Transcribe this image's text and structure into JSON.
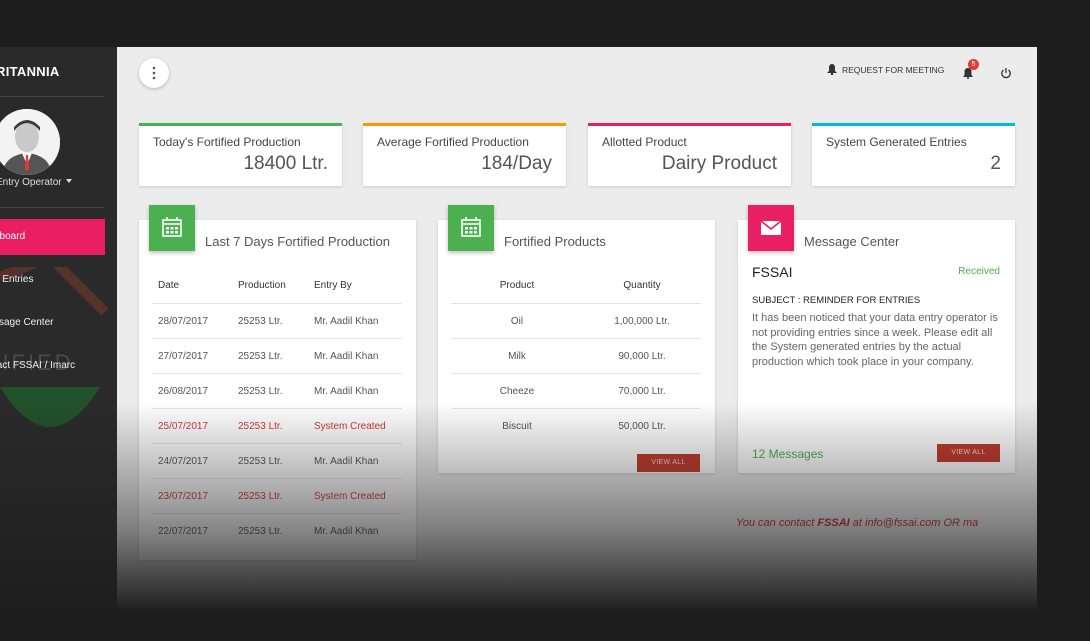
{
  "sidebar": {
    "brand": "RITANNIA",
    "user": "Entry Operator",
    "items": [
      {
        "label": "hboard",
        "active": true
      },
      {
        "label": "a Entries"
      },
      {
        "label": "ssage Center"
      },
      {
        "label": "tact FSSAI / Imarc"
      }
    ],
    "watermark_text": "TIFIED"
  },
  "topbar": {
    "request_label": "REQUEST FOR MEETING",
    "notification_count": "5"
  },
  "stats": [
    {
      "label": "Today's Fortified Production",
      "value": "18400 Ltr.",
      "color": "#4caf50"
    },
    {
      "label": "Average Fortified Production",
      "value": "184/Day",
      "color": "#ff9800"
    },
    {
      "label": "Allotted Product",
      "value": "Dairy Product",
      "color": "#e91e63"
    },
    {
      "label": "System Generated Entries",
      "value": "2",
      "color": "#00bcd4"
    }
  ],
  "production": {
    "title": "Last 7 Days Fortified Production",
    "headers": [
      "Date",
      "Production",
      "Entry By"
    ],
    "rows": [
      [
        "28/07/2017",
        "25253 Ltr.",
        "Mr. Aadil Khan"
      ],
      [
        "27/07/2017",
        "25253 Ltr.",
        "Mr. Aadil Khan"
      ],
      [
        "26/08/2017",
        "25253 Ltr.",
        "Mr. Aadil Khan"
      ],
      [
        "25/07/2017",
        "25253 Ltr.",
        "System Created"
      ],
      [
        "24/07/2017",
        "25253 Ltr.",
        "Mr. Aadil Khan"
      ],
      [
        "23/07/2017",
        "25253 Ltr.",
        "System Created"
      ],
      [
        "22/07/2017",
        "25253 Ltr.",
        "Mr. Aadil Khan"
      ]
    ]
  },
  "products": {
    "title": "Fortified Products",
    "headers": [
      "Product",
      "Quantity"
    ],
    "rows": [
      [
        "Oil",
        "1,00,000 Ltr."
      ],
      [
        "Milk",
        "90,000 Ltr."
      ],
      [
        "Cheeze",
        "70,000 Ltr."
      ],
      [
        "Biscuit",
        "50,000 Ltr."
      ]
    ],
    "view_all": "VIEW ALL"
  },
  "messages": {
    "title": "Message Center",
    "from": "FSSAI",
    "status": "Received",
    "subject": "SUBJECT : REMINDER FOR ENTRIES",
    "body": "It has been noticed that your data entry operator is not providing entries since a week. Please edit all the System generated entries by the actual production which took place in your company.",
    "count": "12 Messages",
    "view_all": "VIEW ALL"
  },
  "footer": {
    "contact_prefix": "You can contact ",
    "contact_org": "FSSAI",
    "contact_mid": " at ",
    "contact_email": "info@fssai.com",
    "contact_suffix": " OR ma"
  }
}
